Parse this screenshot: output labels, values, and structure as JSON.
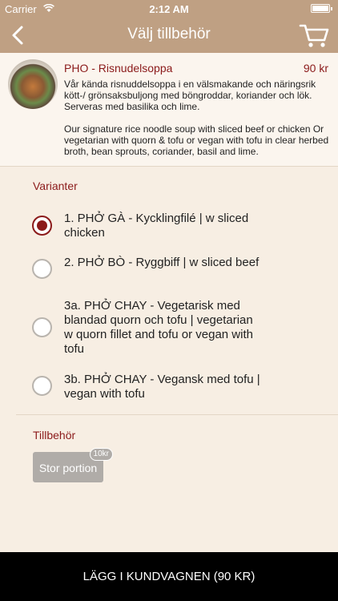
{
  "status": {
    "carrier": "Carrier",
    "time": "2:12 AM"
  },
  "nav": {
    "title": "Välj tillbehör"
  },
  "product": {
    "name": "PHO - Risnudelsoppa",
    "price": "90 kr",
    "desc_sv": "Vår kända risnuddelsoppa i en välsmakande och näringsrik kött-/ grönsaksbuljong med böngroddar, koriander och lök. Serveras med basilika och lime.",
    "desc_en": "Our signature rice noodle soup with sliced beef or chicken Or vegetarian with quorn & tofu or vegan with tofu in clear herbed broth, bean sprouts, coriander, basil and lime."
  },
  "variants": {
    "label": "Varianter",
    "options": [
      {
        "label": "1. PHỞ GÀ - Kycklingfilé | w sliced chicken",
        "selected": true
      },
      {
        "label": "2. PHỞ BÒ - Ryggbiff | w sliced beef",
        "selected": false
      },
      {
        "label": "3a. PHỞ CHAY - Vegetarisk med blandad quorn och tofu | vegetarian w quorn fillet and tofu or vegan with tofu",
        "selected": false
      },
      {
        "label": "3b. PHỞ CHAY - Vegansk med tofu | vegan with tofu",
        "selected": false
      }
    ]
  },
  "addons": {
    "label": "Tillbehör",
    "items": [
      {
        "label": "Stor portion",
        "price": "10kr"
      }
    ]
  },
  "cart_button": "LÄGG I KUNDVAGNEN (90 KR)",
  "colors": {
    "accent": "#8b1a1a",
    "bar": "#bfa083",
    "background": "#f7eee3"
  }
}
